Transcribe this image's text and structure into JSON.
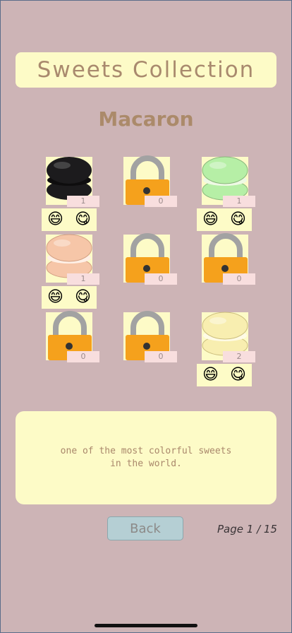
{
  "title": "Sweets Collection",
  "category": "Macaron",
  "items": [
    {
      "state": "unlocked",
      "color": "#1c1b1d",
      "count": "1"
    },
    {
      "state": "locked",
      "count": "0"
    },
    {
      "state": "unlocked",
      "color": "#b6efa6",
      "count": "1"
    },
    {
      "state": "unlocked",
      "color": "#f6c6a8",
      "count": "1"
    },
    {
      "state": "locked",
      "count": "0"
    },
    {
      "state": "locked",
      "count": "0"
    },
    {
      "state": "locked",
      "count": "0"
    },
    {
      "state": "locked",
      "count": "0"
    },
    {
      "state": "unlocked",
      "color": "#f8eeb0",
      "count": "2"
    }
  ],
  "reactions": {
    "grin": "😄",
    "yum": "😋"
  },
  "description": "one of the most colorful sweets\nin the world.",
  "back_label": "Back",
  "page_indicator": "Page  1 / 15"
}
